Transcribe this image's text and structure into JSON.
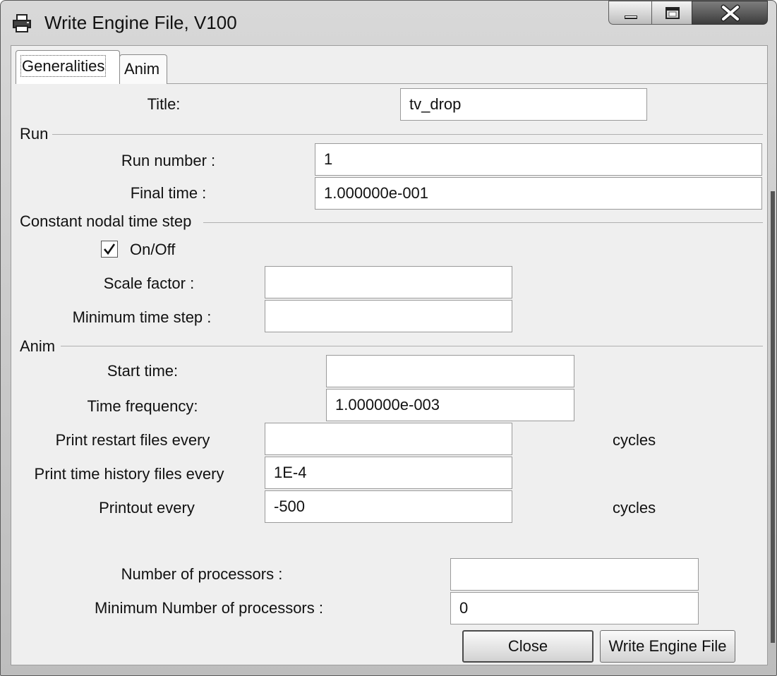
{
  "window": {
    "title": "Write Engine File, V100",
    "app_icon": "printer-icon"
  },
  "controls": {
    "minimize": "minimize-icon",
    "maximize": "maximize-icon",
    "close": "close-icon"
  },
  "tabs": [
    {
      "label": "Generalities",
      "selected": true
    },
    {
      "label": "Anim",
      "selected": false
    }
  ],
  "fields": {
    "title_label": "Title:",
    "title_value": "tv_drop"
  },
  "run": {
    "section": "Run",
    "run_number_label": "Run number :",
    "run_number_value": "1",
    "final_time_label": "Final time :",
    "final_time_value": "1.000000e-001"
  },
  "timestep": {
    "section": "Constant nodal time step",
    "onoff_label": "On/Off",
    "onoff_checked": true,
    "scale_factor_label": "Scale factor :",
    "scale_factor_value": "",
    "min_time_step_label": "Minimum time step :",
    "min_time_step_value": ""
  },
  "anim": {
    "section": "Anim",
    "start_time_label": "Start time:",
    "start_time_value": "",
    "time_freq_label": "Time frequency:",
    "time_freq_value": "1.000000e-003",
    "restart_label": "Print restart files every",
    "restart_value": "",
    "restart_unit": "cycles",
    "th_label": "Print time history files every",
    "th_value": "1E-4",
    "printout_label": "Printout every",
    "printout_value": "-500",
    "printout_unit": "cycles"
  },
  "processors": {
    "num_label": "Number of processors :",
    "num_value": "",
    "min_label": "Minimum Number of processors :",
    "min_value": "0"
  },
  "buttons": {
    "close": "Close",
    "write": "Write Engine File"
  }
}
